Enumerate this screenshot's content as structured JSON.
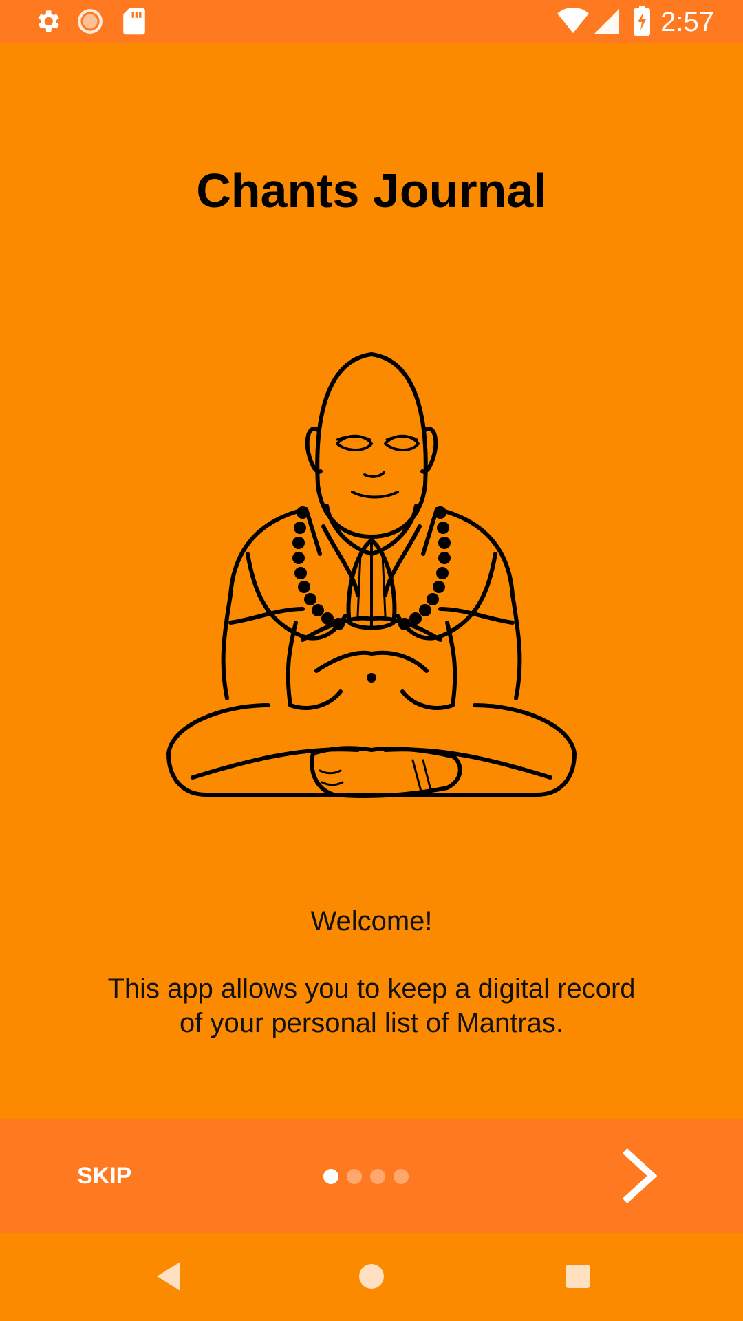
{
  "status_bar": {
    "time": "2:57",
    "left_icons": [
      "gear-icon",
      "sync-icon",
      "sd-card-icon"
    ],
    "right_icons": [
      "wifi-icon",
      "signal-icon",
      "battery-charging-icon"
    ]
  },
  "title": "Chants Journal",
  "illustration": "praying-monk-icon",
  "welcome_text": "Welcome!",
  "description": "This app allows you to keep a digital record of your personal list of Mantras.",
  "intro_nav": {
    "skip_label": "SKIP",
    "page_count": 4,
    "active_page": 1,
    "next_icon": "chevron-right-icon"
  },
  "system_nav": [
    "back-icon",
    "home-icon",
    "recents-icon"
  ],
  "colors": {
    "background": "#FB8A00",
    "bar": "#FF7920",
    "text": "#000000",
    "icon": "#FFFFFF"
  }
}
